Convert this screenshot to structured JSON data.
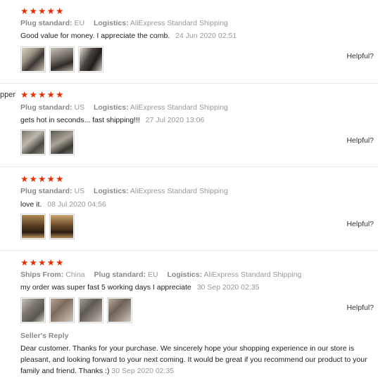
{
  "reviews": [
    {
      "username": "",
      "stars": 5,
      "meta": [
        {
          "key": "Plug standard:",
          "value": "EU"
        },
        {
          "key": "Logistics:",
          "value": "AliExpress Standard Shipping"
        }
      ],
      "comment": "Good value for money. I appreciate the comb.",
      "date": "24 Jun 2020 02:51",
      "photo_count": 3,
      "helpful": "Helpful?"
    },
    {
      "username": "pper",
      "stars": 5,
      "meta": [
        {
          "key": "Plug standard:",
          "value": "US"
        },
        {
          "key": "Logistics:",
          "value": "AliExpress Standard Shipping"
        }
      ],
      "comment": "gets hot in seconds... fast shipping!!!",
      "date": "27 Jul 2020 13:06",
      "photo_count": 2,
      "helpful": "Helpful?"
    },
    {
      "username": "",
      "stars": 5,
      "meta": [
        {
          "key": "Plug standard:",
          "value": "US"
        },
        {
          "key": "Logistics:",
          "value": "AliExpress Standard Shipping"
        }
      ],
      "comment": "love it.",
      "date": "08 Jul 2020 04:56",
      "photo_count": 2,
      "helpful": "Helpful?"
    },
    {
      "username": "",
      "stars": 5,
      "meta": [
        {
          "key": "Ships From:",
          "value": "China"
        },
        {
          "key": "Plug standard:",
          "value": "EU"
        },
        {
          "key": "Logistics:",
          "value": "AliExpress Standard Shipping"
        }
      ],
      "comment": "my order was super fast 5 working days I appreciate",
      "date": "30 Sep 2020 02:35",
      "photo_count": 4,
      "helpful": "Helpful?",
      "seller_reply": {
        "label": "Seller's Reply",
        "text": "Dear customer. Thanks for your purchase. We sincerely hope your shopping experience in our store is pleasant, and looking forward to your next coming. It would be great if you recommend our product to your family and friend. Thanks :)",
        "date": "30 Sep 2020 02:35"
      }
    }
  ],
  "colors": {
    "star": "#e62e04",
    "meta": "#999999",
    "divider": "#e8e8e8"
  },
  "icons": {
    "star": "star-icon"
  }
}
